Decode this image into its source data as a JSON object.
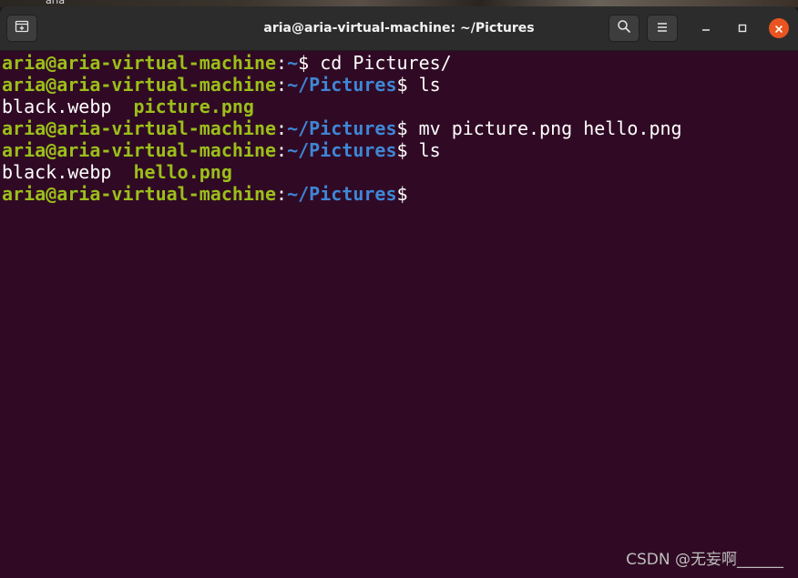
{
  "desktop": {
    "label": "aria"
  },
  "window": {
    "title": "aria@aria-virtual-machine: ~/Pictures"
  },
  "terminal": {
    "lines": [
      {
        "user": "aria@aria-virtual-machine",
        "sep": ":",
        "path": "~",
        "prompt": "$ ",
        "cmd": "cd Pictures/"
      },
      {
        "user": "aria@aria-virtual-machine",
        "sep": ":",
        "path": "~/Pictures",
        "prompt": "$ ",
        "cmd": "ls"
      },
      {
        "out": [
          {
            "text": "black.webp",
            "style": "plain"
          },
          {
            "text": "  ",
            "style": "plain"
          },
          {
            "text": "picture.png",
            "style": "exe"
          }
        ]
      },
      {
        "user": "aria@aria-virtual-machine",
        "sep": ":",
        "path": "~/Pictures",
        "prompt": "$ ",
        "cmd": "mv picture.png hello.png"
      },
      {
        "user": "aria@aria-virtual-machine",
        "sep": ":",
        "path": "~/Pictures",
        "prompt": "$ ",
        "cmd": "ls"
      },
      {
        "out": [
          {
            "text": "black.webp",
            "style": "plain"
          },
          {
            "text": "  ",
            "style": "plain"
          },
          {
            "text": "hello.png",
            "style": "exe"
          }
        ]
      },
      {
        "user": "aria@aria-virtual-machine",
        "sep": ":",
        "path": "~/Pictures",
        "prompt": "$ ",
        "cmd": ""
      }
    ]
  },
  "watermark": "CSDN @无妄啊______",
  "colors": {
    "terminal_bg": "#300a24",
    "user_green": "#9bbf1a",
    "path_blue": "#3f86d6",
    "close_orange": "#e95420"
  },
  "icons": {
    "new_tab": "new-tab-icon",
    "search": "search-icon",
    "menu": "hamburger-menu-icon",
    "minimize": "minimize-icon",
    "maximize": "maximize-icon",
    "close": "close-icon"
  }
}
